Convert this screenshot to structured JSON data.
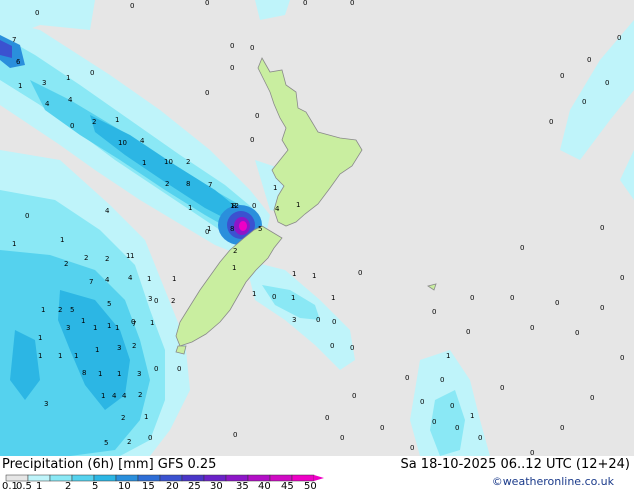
{
  "title": "Precipitation (6h) [mm] GFS 0.25",
  "datetime": "Sa 18-10-2025 06..12 UTC (12+24)",
  "credit": "©weatheronline.co.uk",
  "colors": {
    "sea": "#e6e6e6",
    "land": "#c9eea0",
    "coast": "#8a8a8a",
    "border": "#9aa0b0"
  },
  "legend": {
    "labels": [
      "0.1",
      "0.5",
      "1",
      "2",
      "5",
      "10",
      "15",
      "20",
      "25",
      "30",
      "35",
      "40",
      "45",
      "50"
    ],
    "colors": [
      "#e6e6e6",
      "#bff4fa",
      "#8ae8f5",
      "#55d2ee",
      "#2cb6e4",
      "#2a8fdc",
      "#2e6ed6",
      "#3b52d0",
      "#4a36c8",
      "#6a22c8",
      "#8d16c8",
      "#b20ec6",
      "#d00ac4",
      "#ee00c6"
    ]
  },
  "map_numbers": [
    "0",
    "0",
    "0",
    "0",
    "0",
    "0",
    "0",
    "0",
    "0",
    "0",
    "0",
    "0",
    "0",
    "0",
    "0",
    "0",
    "0",
    "0",
    "7",
    "6",
    "1",
    "3",
    "1",
    "4",
    "4",
    "0",
    "2",
    "1",
    "10",
    "4",
    "1",
    "10",
    "2",
    "2",
    "8",
    "7",
    "1",
    "12",
    "0",
    "1",
    "8",
    "8",
    "5",
    "4",
    "4",
    "1",
    "1",
    "2",
    "1",
    "0",
    "1",
    "0",
    "1",
    "2",
    "2",
    "2",
    "1",
    "7",
    "4",
    "4",
    "1",
    "1",
    "2",
    "1",
    "5",
    "3",
    "0",
    "1",
    "1",
    "1",
    "2",
    "5",
    "3",
    "1",
    "1",
    "1",
    "7",
    "1",
    "0",
    "1",
    "1",
    "1",
    "1",
    "3",
    "2",
    "8",
    "1",
    "1",
    "3",
    "4",
    "2",
    "3",
    "1",
    "4",
    "2",
    "1",
    "5",
    "2",
    "0",
    "0",
    "0",
    "0",
    "0",
    "0",
    "0",
    "0",
    "0",
    "0",
    "0",
    "1",
    "1",
    "1",
    "0",
    "0",
    "0",
    "1",
    "3",
    "1",
    "0",
    "1",
    "0",
    "1",
    "0",
    "0",
    "0",
    "0",
    "0",
    "0",
    "0",
    "0",
    "0",
    "0",
    "0",
    "0",
    "0",
    "0",
    "0",
    "0",
    "0",
    "0",
    "0",
    "0",
    "0",
    "0"
  ]
}
